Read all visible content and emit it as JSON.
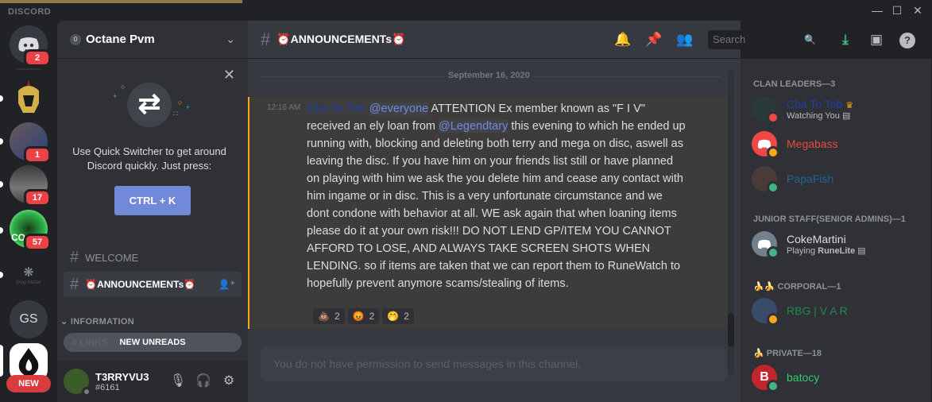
{
  "titlebar": {
    "brand": "DISCORD",
    "minimize": "—",
    "maximize": "☐",
    "close": "✕"
  },
  "guilds": {
    "home_badge": "2",
    "items": [
      {
        "name": "spartan-helmet-server",
        "badge": ""
      },
      {
        "name": "server-2",
        "badge": "1"
      },
      {
        "name": "server-3",
        "badge": "17"
      },
      {
        "name": "server-co",
        "badge": "57"
      },
      {
        "name": "gray-matter",
        "label": "Gray Matter",
        "badge": ""
      },
      {
        "name": "gs-server",
        "initials": "GS",
        "badge": ""
      },
      {
        "name": "flame-server",
        "badge": ""
      }
    ],
    "new_label": "NEW"
  },
  "sidebar": {
    "server_name": "Octane Pvm",
    "quick_switcher": {
      "text": "Use Quick Switcher to get around Discord quickly. Just press:",
      "shortcut": "CTRL + K"
    },
    "channels": [
      {
        "name": "WELCOME",
        "active": false
      },
      {
        "name": "⏰ANNOUNCEMENTs⏰",
        "active": true
      }
    ],
    "category": "INFORMATION",
    "hidden_channel": "LINKS",
    "new_unreads": "NEW UNREADS",
    "user": {
      "name": "T3RRYVU3",
      "tag": "#6161"
    }
  },
  "chat": {
    "channel_title": "⏰ANNOUNCEMENTs⏰",
    "search_placeholder": "Search",
    "date_divider": "September 16, 2020",
    "message": {
      "time": "12:16 AM",
      "author": "Cba To Tob",
      "mention_everyone": "@everyone",
      "text_1": " ATTENTION Ex member known as \"F I V\" received an ely loan from ",
      "mention_user": "@Legendtary",
      "text_2": " this evening to which he ended up running with, blocking and deleting both terry and mega on disc, aswell as leaving the disc. If you have him on your friends list still or have planned on playing with him we ask the you delete him and cease any contact with him ingame or in disc. This is a very unfortunate circumstance and we dont condone with behavior at all. WE ask again that when loaning items please do it at your own risk!!! DO NOT LEND GP/ITEM YOU CANNOT AFFORD TO LOSE, AND ALWAYS TAKE SCREEN SHOTS WHEN LENDING. so if items are taken that we can report them to RuneWatch to hopefully prevent anymore scams/stealing of items.",
      "reactions": [
        {
          "emoji": "💩",
          "count": "2"
        },
        {
          "emoji": "😡",
          "count": "2"
        },
        {
          "emoji": "🤭",
          "count": "2"
        }
      ]
    },
    "composer_placeholder": "You do not have permission to send messages in this channel."
  },
  "members": {
    "groups": [
      {
        "title": "CLAN LEADERS—3",
        "members": [
          {
            "name": "Cba To Tob",
            "color": "#1f3fa8",
            "activity": "Watching You",
            "status": "dnd",
            "owner": true
          },
          {
            "name": "Megabass",
            "color": "#e74c3c",
            "activity": "",
            "status": "idle"
          },
          {
            "name": "PapaFish",
            "color": "#206694",
            "activity": "",
            "status": "online"
          }
        ]
      },
      {
        "title": "JUNIOR STAFF(SENIOR ADMINS)—1",
        "members": [
          {
            "name": "CokeMartini",
            "color": "#dcddde",
            "activity_prefix": "Playing ",
            "activity": "RuneLite",
            "status": "online"
          }
        ]
      },
      {
        "title": "🍌🍌 CORPORAL—1",
        "members": [
          {
            "name": "RBG | V A R",
            "color": "#1f8b4c",
            "activity": "",
            "status": "idle"
          }
        ]
      },
      {
        "title": "🍌 PRIVATE—18",
        "members": [
          {
            "name": "batocy",
            "color": "#2ecc71",
            "activity": "",
            "status": "online"
          }
        ]
      }
    ]
  },
  "colors": {
    "accent": "#7289da",
    "online": "#43b581",
    "idle": "#faa61a",
    "dnd": "#f04747",
    "offline": "#747f8d",
    "download": "#43b581"
  }
}
